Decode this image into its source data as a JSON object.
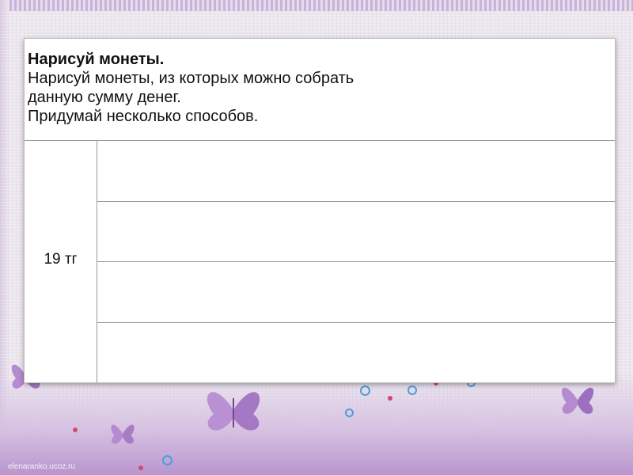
{
  "task": {
    "title": "Нарисуй монеты.",
    "lines": [
      "Нарисуй монеты, из которых можно собрать",
      "данную сумму денег.",
      "Придумай несколько способов."
    ]
  },
  "table": {
    "sum_label": "19 тг",
    "answer_rows": 4
  },
  "footer": {
    "credit": "elenaranko.ucoz.ru"
  },
  "colors": {
    "background": "#ece7ef",
    "accent_purple": "#a77cc4",
    "grid": "#9a9a9a"
  }
}
